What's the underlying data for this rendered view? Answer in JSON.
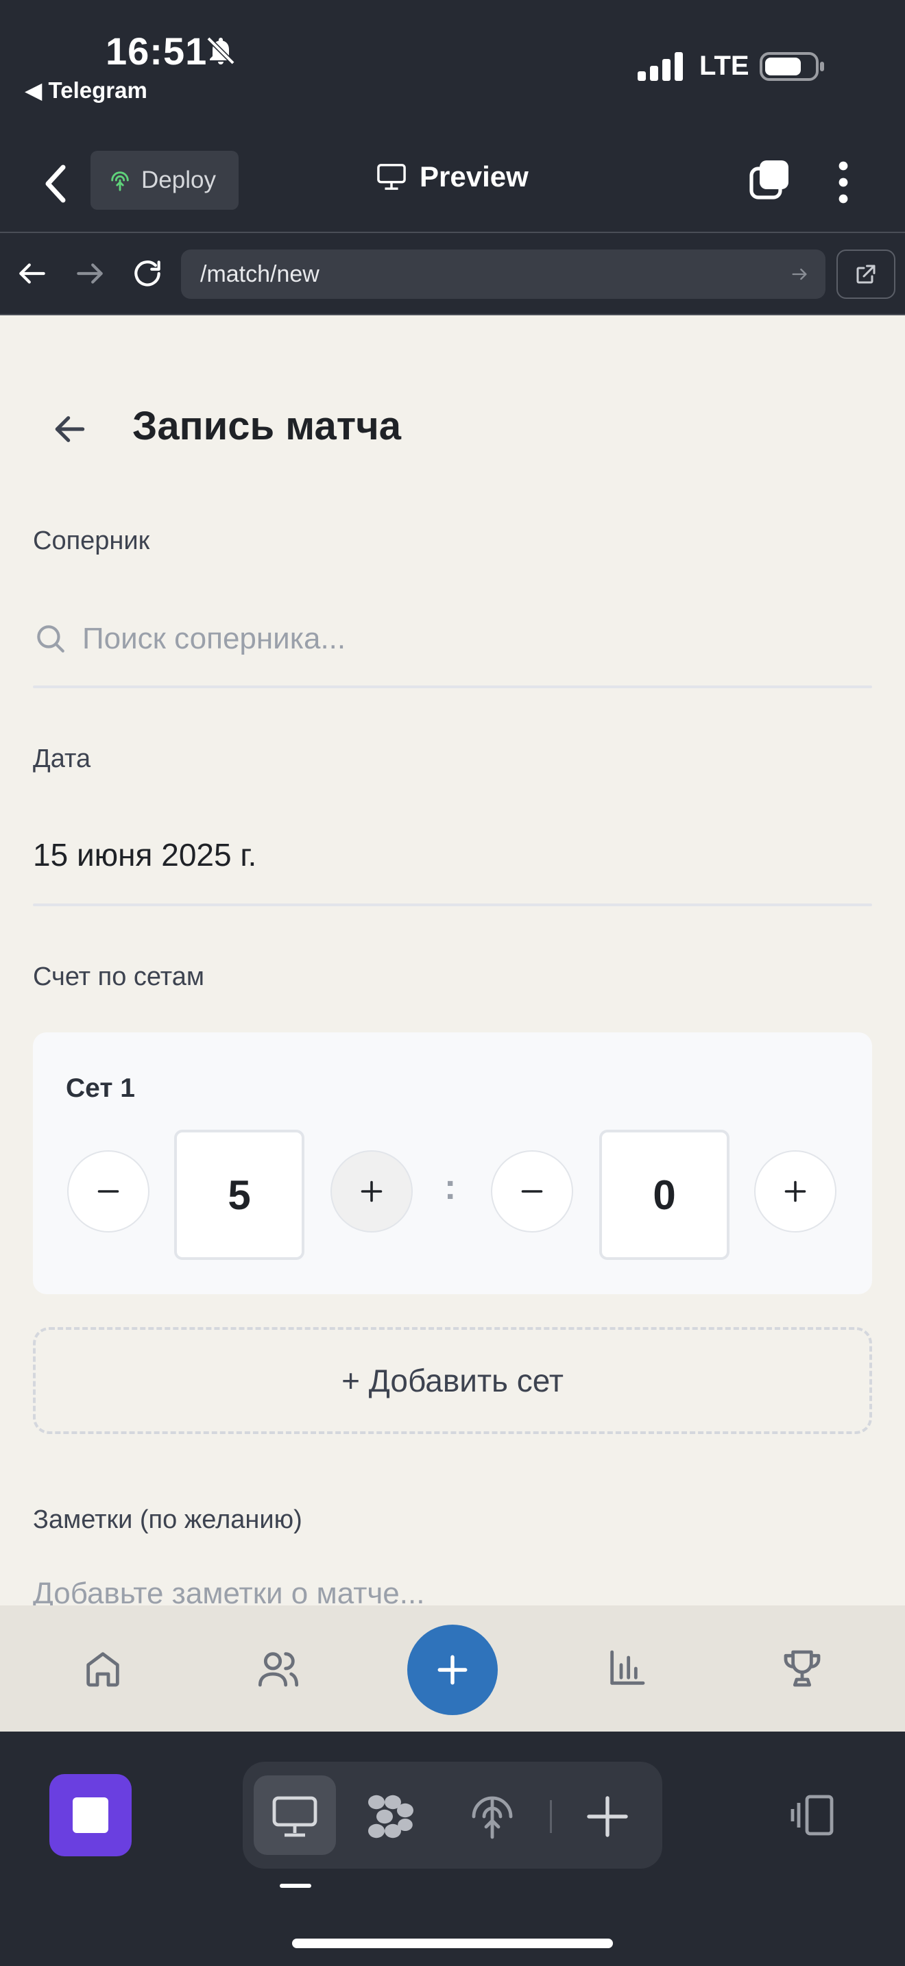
{
  "status_bar": {
    "time": "16:51",
    "back_app": "◀ Telegram",
    "network": "LTE"
  },
  "toolbar": {
    "deploy_label": "Deploy",
    "preview_label": "Preview"
  },
  "url_bar": {
    "url": "/match/new"
  },
  "page": {
    "title": "Запись матча",
    "opponent": {
      "label": "Соперник",
      "placeholder": "Поиск соперника..."
    },
    "date": {
      "label": "Дата",
      "value": "15 июня 2025 г."
    },
    "sets": {
      "label": "Счет по сетам",
      "items": [
        {
          "title": "Сет 1",
          "score_a": "5",
          "separator": ":",
          "score_b": "0"
        }
      ],
      "add_label": "+ Добавить сет"
    },
    "notes": {
      "label": "Заметки (по желанию)",
      "placeholder": "Добавьте заметки о матче..."
    }
  },
  "bottom_nav": {
    "items": [
      "home-icon",
      "users-icon",
      "add-icon",
      "stats-icon",
      "trophy-icon"
    ],
    "accent_color": "#2f73bb"
  },
  "dock": {
    "stop_color": "#6a3fe0",
    "items": [
      "desktop-icon",
      "apps-icon",
      "deploy-icon",
      "add-icon"
    ]
  }
}
